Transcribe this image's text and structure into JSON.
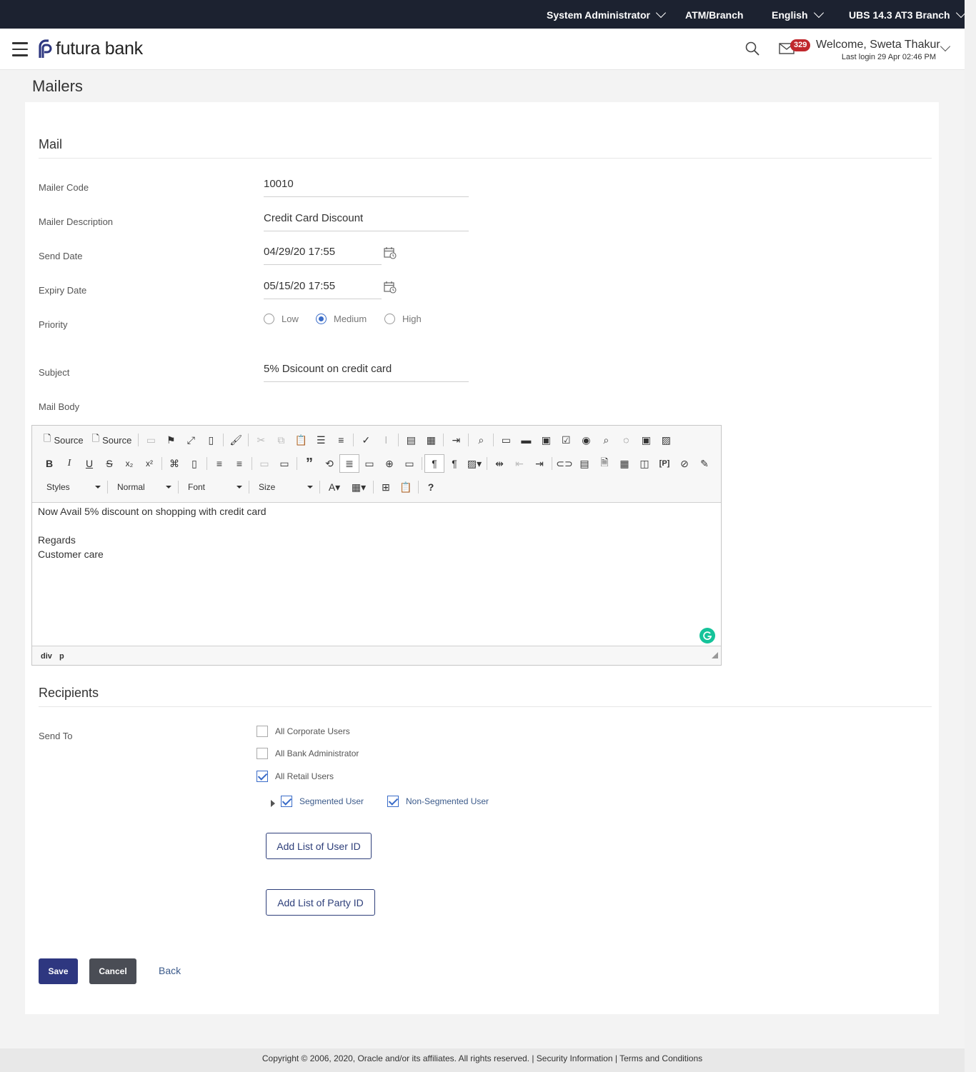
{
  "topbar": {
    "role": "System Administrator",
    "location": "ATM/Branch",
    "language": "English",
    "branch": "UBS 14.3 AT3 Branch"
  },
  "header": {
    "brand": "futura bank",
    "notification_count": "329",
    "welcome": "Welcome, Sweta Thakur",
    "last_login": "Last login 29 Apr 02:46 PM"
  },
  "page_title": "Mailers",
  "mail": {
    "section_title": "Mail",
    "fields": {
      "mailer_code_label": "Mailer Code",
      "mailer_code": "10010",
      "mailer_description_label": "Mailer Description",
      "mailer_description": "Credit Card Discount",
      "send_date_label": "Send Date",
      "send_date": "04/29/20 17:55",
      "expiry_date_label": "Expiry Date",
      "expiry_date": "05/15/20 17:55",
      "priority_label": "Priority",
      "priority_options": [
        "Low",
        "Medium",
        "High"
      ],
      "priority_selected": "Medium",
      "subject_label": "Subject",
      "subject": "5% Dsicount on credit card",
      "mail_body_label": "Mail Body"
    }
  },
  "editor": {
    "toolbar": {
      "source_1": "Source",
      "source_2": "Source",
      "styles": "Styles",
      "format": "Normal",
      "font": "Font",
      "size": "Size"
    },
    "body": [
      "Now Avail 5% discount on shopping with credit card",
      "",
      "Regards",
      "Customer care"
    ],
    "status_path": [
      "div",
      "p"
    ]
  },
  "recipients": {
    "section_title": "Recipients",
    "send_to_label": "Send To",
    "options": [
      {
        "label": "All Corporate Users",
        "checked": false
      },
      {
        "label": "All Bank Administrator",
        "checked": false
      },
      {
        "label": "All Retail Users",
        "checked": true
      }
    ],
    "sub_options": [
      {
        "label": "Segmented User",
        "checked": true
      },
      {
        "label": "Non-Segmented User",
        "checked": true
      }
    ],
    "add_user_list": "Add List of User ID",
    "add_party_list": "Add List of Party ID"
  },
  "actions": {
    "save": "Save",
    "cancel": "Cancel",
    "back": "Back"
  },
  "footer": {
    "text": "Copyright © 2006, 2020, Oracle and/or its affiliates. All rights reserved. | Security Information | Terms and Conditions"
  },
  "colors": {
    "topbar_bg": "#1c2230",
    "primary": "#2e3780",
    "badge": "#c0282d",
    "radio_checkbox_accent": "#3a6cc8"
  }
}
